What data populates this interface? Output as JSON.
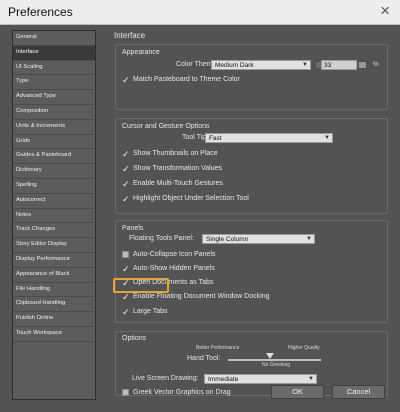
{
  "window": {
    "title": "Preferences"
  },
  "sidebar": {
    "items": [
      "General",
      "Interface",
      "UI Scaling",
      "Type",
      "Advanced Type",
      "Composition",
      "Units & Increments",
      "Grids",
      "Guides & Pasteboard",
      "Dictionary",
      "Spelling",
      "Autocorrect",
      "Notes",
      "Track Changes",
      "Story Editor Display",
      "Display Performance",
      "Appearance of Black",
      "File Handling",
      "Clipboard Handling",
      "Publish Online",
      "Touch Workspace"
    ],
    "selected": "Interface"
  },
  "page": {
    "title": "Interface"
  },
  "appearance": {
    "title": "Appearance",
    "color_theme_label": "Color Theme:",
    "color_theme_value": "Medium Dark",
    "theme_number": "33",
    "percent": "%",
    "match_pasteboard": "Match Pasteboard to Theme Color"
  },
  "cursor": {
    "title": "Cursor and Gesture Options",
    "tool_tips_label": "Tool Tips:",
    "tool_tips_value": "Fast",
    "show_thumbnails": "Show Thumbnails on Place",
    "show_transform": "Show Transformation Values",
    "enable_multitouch": "Enable Multi-Touch Gestures",
    "highlight_object": "Highlight Object Under Selection Tool"
  },
  "panels": {
    "title": "Panels",
    "floating_label": "Floating Tools Panel:",
    "floating_value": "Single Column",
    "auto_collapse": "Auto-Collapse Icon Panels",
    "auto_show": "Auto-Show Hidden Panels",
    "open_docs_tabs": "Open Documents as Tabs",
    "enable_floating_docking": "Enable Floating Document Window Docking",
    "large_tabs": "Large Tabs"
  },
  "options": {
    "title": "Options",
    "better_performance": "Better Performance",
    "higher_quality": "Higher Quality",
    "hand_tool_label": "Hand Tool:",
    "no_greeking": "No Greeking",
    "live_screen_label": "Live Screen Drawing:",
    "live_screen_value": "Immediate",
    "greek_vector": "Greek Vector Graphics on Drag"
  },
  "buttons": {
    "ok": "OK",
    "cancel": "Cancel"
  }
}
